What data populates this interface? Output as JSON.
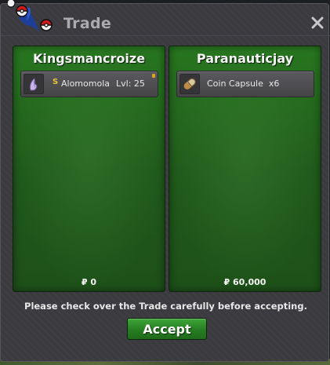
{
  "window": {
    "title": "Trade",
    "close_icon": "close-x-icon",
    "logo_icon": "pokeball-pokemon-logo-icon"
  },
  "trade": {
    "left": {
      "player_name": "Kingsmancroize",
      "item": {
        "icon": "pokemon-sprite-icon",
        "shiny_badge": "S",
        "name": "Alomomola",
        "level": "Lvl: 25"
      },
      "money": "₽ 0"
    },
    "right": {
      "player_name": "Paranauticjay",
      "item": {
        "icon": "coin-capsule-icon",
        "text": "Coin Capsule  x6"
      },
      "money": "₽ 60,000"
    }
  },
  "footer": {
    "notice": "Please check over the Trade carefully before accepting.",
    "accept_label": "Accept"
  },
  "colors": {
    "panel_green": "#227020",
    "window_bg": "#3a3a3f",
    "accept_green": "#2d8a27"
  }
}
